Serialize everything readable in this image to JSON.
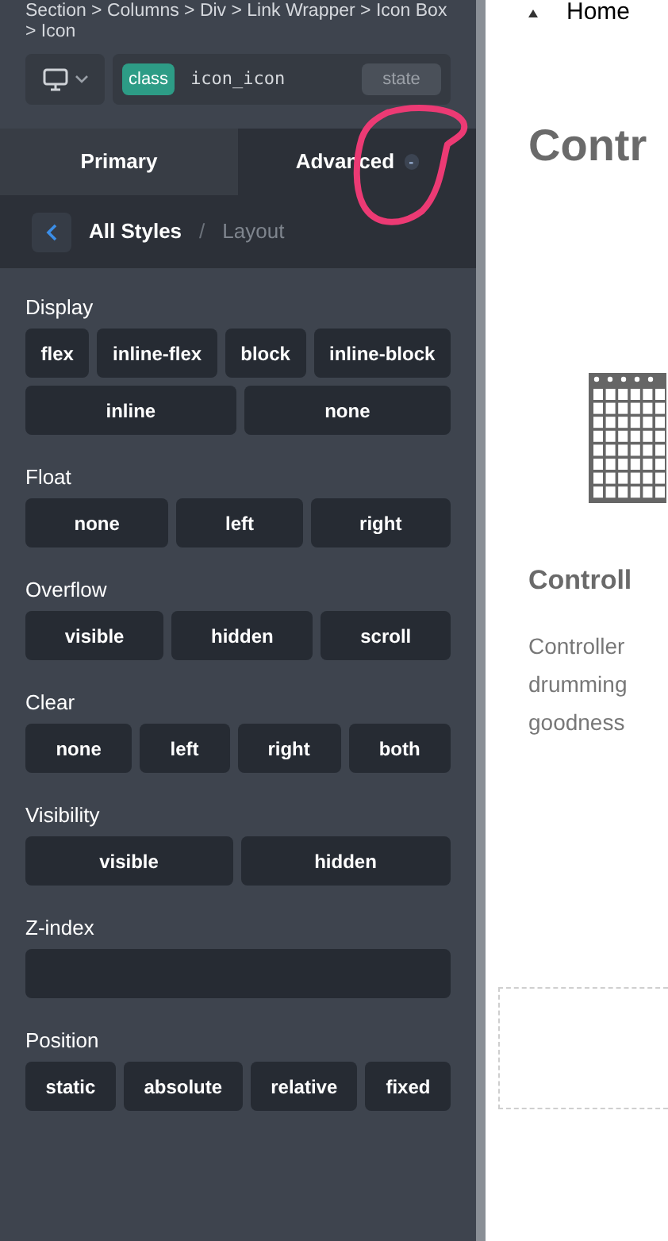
{
  "breadcrumb": "Section > Columns > Div > Link Wrapper > Icon Box > Icon",
  "selector": {
    "chip": "class",
    "class_name": "icon_icon",
    "state_button": "state"
  },
  "tabs": [
    {
      "label": "Primary",
      "selected": false
    },
    {
      "label": "Advanced",
      "selected": true,
      "badge": "-"
    }
  ],
  "subnav": {
    "current": "All Styles",
    "separator": "/",
    "section": "Layout"
  },
  "groups": [
    {
      "label": "Display",
      "kind": "buttons",
      "options": [
        "flex",
        "inline-flex",
        "block",
        "inline-block",
        "inline",
        "none"
      ]
    },
    {
      "label": "Float",
      "kind": "buttons",
      "options": [
        "none",
        "left",
        "right"
      ]
    },
    {
      "label": "Overflow",
      "kind": "buttons",
      "options": [
        "visible",
        "hidden",
        "scroll"
      ]
    },
    {
      "label": "Clear",
      "kind": "buttons",
      "options": [
        "none",
        "left",
        "right",
        "both"
      ]
    },
    {
      "label": "Visibility",
      "kind": "buttons",
      "options": [
        "visible",
        "hidden"
      ]
    },
    {
      "label": "Z-index",
      "kind": "field"
    },
    {
      "label": "Position",
      "kind": "buttons",
      "options": [
        "static",
        "absolute",
        "relative",
        "fixed"
      ]
    }
  ],
  "preview": {
    "nav_link": "Home",
    "heading": "Contr",
    "card_title": "Controll",
    "card_text": [
      "Controller",
      "drumming",
      "goodness"
    ]
  }
}
